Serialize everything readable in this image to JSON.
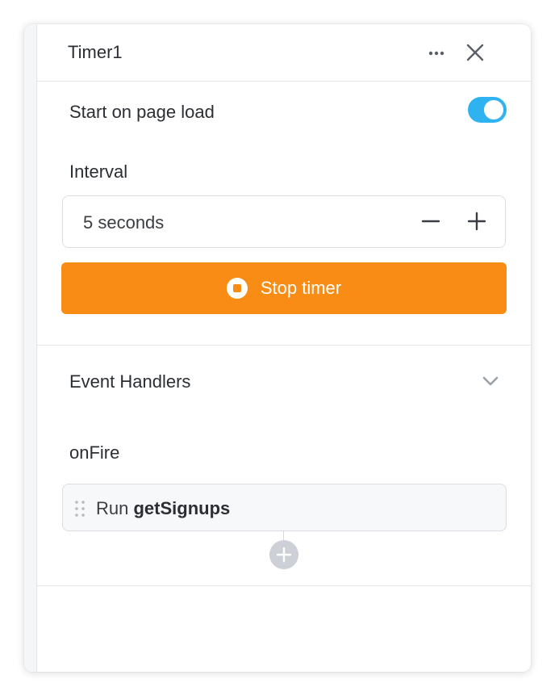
{
  "header": {
    "title": "Timer1",
    "more_icon": "more-horizontal-icon",
    "close_icon": "close-icon"
  },
  "settings": {
    "start_on_load_label": "Start on page load",
    "start_on_load_enabled": true,
    "interval_label": "Interval",
    "interval_value": "5 seconds",
    "decrement_icon": "minus-icon",
    "increment_icon": "plus-icon",
    "stop_button_label": "Stop timer",
    "stop_icon": "stop-circle-icon"
  },
  "event_handlers": {
    "section_label": "Event Handlers",
    "chevron_icon": "chevron-down-icon",
    "event_name": "onFire",
    "handlers": [
      {
        "prefix": "Run",
        "query": "getSignups"
      }
    ],
    "add_icon": "plus-icon"
  },
  "colors": {
    "accent_orange": "#f98c14",
    "toggle_blue": "#2fb3f0",
    "text_dark": "#2b2e33",
    "border": "#e2e4e8",
    "add_button_gray": "#cdd0d6"
  }
}
